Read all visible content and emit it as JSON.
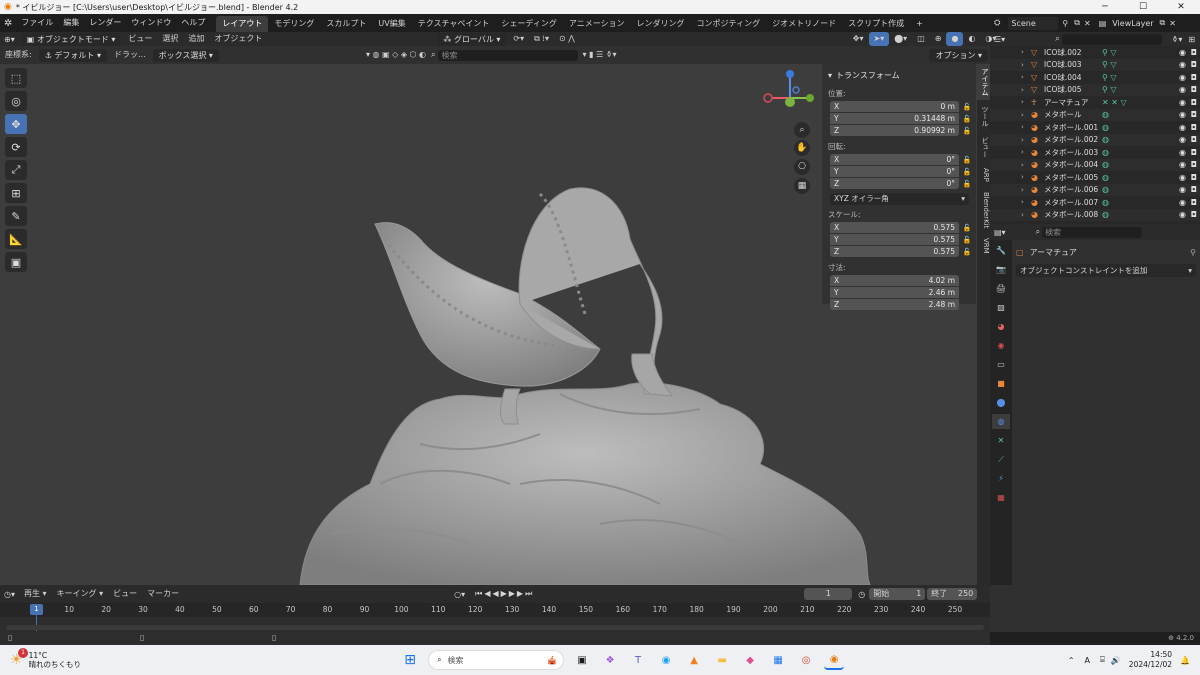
{
  "window": {
    "title": "* イビルジョー [C:\\Users\\user\\Desktop\\イビルジョー.blend] - Blender 4.2"
  },
  "menubar": {
    "menus": [
      "ファイル",
      "編集",
      "レンダー",
      "ウィンドウ",
      "ヘルプ"
    ],
    "workspaces": [
      "レイアウト",
      "モデリング",
      "スカルプト",
      "UV編集",
      "テクスチャペイント",
      "シェーディング",
      "アニメーション",
      "レンダリング",
      "コンポジティング",
      "ジオメトリノード",
      "スクリプト作成"
    ],
    "add_tab": "+",
    "scene_label": "Scene",
    "viewlayer_label": "ViewLayer"
  },
  "viewport_header": {
    "mode": "オブジェクトモード",
    "menus": [
      "ビュー",
      "選択",
      "追加",
      "オブジェクト"
    ],
    "transform_orientation": "グローバル",
    "coord_label": "座標系:",
    "coord_value": "デフォルト",
    "drag_label": "ドラッ...",
    "box_select": "ボックス選択",
    "search_placeholder": "検索",
    "options": "オプション"
  },
  "npanel": {
    "section": "トランスフォーム",
    "location_label": "位置:",
    "location": [
      {
        "axis": "X",
        "value": "0 m"
      },
      {
        "axis": "Y",
        "value": "0.31448 m"
      },
      {
        "axis": "Z",
        "value": "0.90992 m"
      }
    ],
    "rotation_label": "回転:",
    "rotation": [
      {
        "axis": "X",
        "value": "0°"
      },
      {
        "axis": "Y",
        "value": "0°"
      },
      {
        "axis": "Z",
        "value": "0°"
      }
    ],
    "rotation_mode": "XYZ オイラー角",
    "scale_label": "スケール:",
    "scale": [
      {
        "axis": "X",
        "value": "0.575"
      },
      {
        "axis": "Y",
        "value": "0.575"
      },
      {
        "axis": "Z",
        "value": "0.575"
      }
    ],
    "dimensions_label": "寸法:",
    "dimensions": [
      {
        "axis": "X",
        "value": "4.02 m"
      },
      {
        "axis": "Y",
        "value": "2.46 m"
      },
      {
        "axis": "Z",
        "value": "2.48 m"
      }
    ]
  },
  "sidetabs": [
    "アイテム",
    "ツール",
    "ビュー",
    "ARP",
    "BlenderKit",
    "VRM"
  ],
  "outliner": {
    "search_placeholder": "",
    "rows": [
      {
        "name": "ICO球.002",
        "type": "mesh"
      },
      {
        "name": "ICO球.003",
        "type": "mesh"
      },
      {
        "name": "ICO球.004",
        "type": "mesh"
      },
      {
        "name": "ICO球.005",
        "type": "mesh"
      },
      {
        "name": "アーマチュア",
        "type": "armature"
      },
      {
        "name": "メタボール",
        "type": "meta"
      },
      {
        "name": "メタボール.001",
        "type": "meta"
      },
      {
        "name": "メタボール.002",
        "type": "meta"
      },
      {
        "name": "メタボール.003",
        "type": "meta"
      },
      {
        "name": "メタボール.004",
        "type": "meta"
      },
      {
        "name": "メタボール.005",
        "type": "meta"
      },
      {
        "name": "メタボール.006",
        "type": "meta"
      },
      {
        "name": "メタボール.007",
        "type": "meta"
      },
      {
        "name": "メタボール.008",
        "type": "meta"
      }
    ]
  },
  "properties": {
    "search_placeholder": "検索",
    "object_name": "アーマチュア",
    "add_constraint": "オブジェクトコンストレイントを追加"
  },
  "timeline": {
    "menus": [
      "再生",
      "キーイング",
      "ビュー",
      "マーカー"
    ],
    "current_frame": "1",
    "start_label": "開始",
    "start": "1",
    "end_label": "終了",
    "end": "250",
    "ticks": [
      "1",
      "10",
      "20",
      "30",
      "40",
      "50",
      "60",
      "70",
      "80",
      "90",
      "100",
      "110",
      "120",
      "130",
      "140",
      "150",
      "160",
      "170",
      "180",
      "190",
      "200",
      "210",
      "220",
      "230",
      "240",
      "250"
    ]
  },
  "statusbar": {
    "version": "4.2.0"
  },
  "taskbar": {
    "weather_temp": "11°C",
    "weather_desc": "晴れのちくもり",
    "weather_badge": "1",
    "search_placeholder": "検索",
    "ime": "A",
    "time": "14:50",
    "date": "2024/12/02"
  },
  "colors": {
    "accent": "#4772b3",
    "viewport_bg": "#3d3d3d",
    "mesh_icon": "#e8873a",
    "data_icon": "#58c3a6"
  }
}
